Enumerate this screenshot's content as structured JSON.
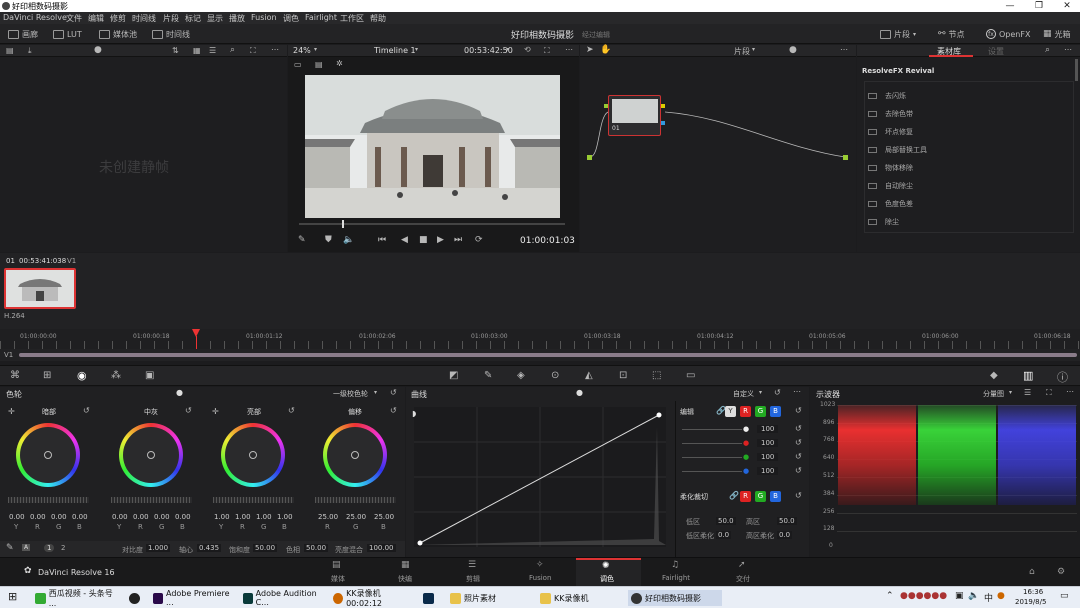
{
  "window": {
    "title": "好印相数码摄影"
  },
  "menu": [
    "DaVinci Resolve",
    "文件",
    "编辑",
    "修剪",
    "时间线",
    "片段",
    "标记",
    "显示",
    "播放",
    "Fusion",
    "调色",
    "Fairlight",
    "工作区",
    "帮助"
  ],
  "toolbar": {
    "gallery": "画廊",
    "lut": "LUT",
    "media_pool": "媒体池",
    "timeline": "时间线",
    "project": "好印相数码摄影",
    "status": "经过编辑",
    "clips": "片段",
    "nodes": "节点",
    "openfx": "OpenFX",
    "lightbox": "光箱"
  },
  "viewer": {
    "zoom": "24%",
    "timeline_name": "Timeline 1",
    "source_tc": "00:53:42:50",
    "no_still": "未创建静帧",
    "timecode": "01:00:01:03"
  },
  "node_panel": {
    "mode": "片段",
    "node_label": "01"
  },
  "fx_panel": {
    "tab_library": "素材库",
    "tab_settings": "设置",
    "header": "ResolveFX Revival",
    "items": [
      "去闪烁",
      "去除色带",
      "坏点修复",
      "局部替换工具",
      "物体移除",
      "自动除尘",
      "色度色差",
      "除尘"
    ]
  },
  "clip_strip": {
    "index": "01",
    "timecode": "00:53:41:038",
    "track": "V1",
    "codec": "H.264"
  },
  "ruler": [
    "01:00:00:00",
    "01:00:00:18",
    "01:00:01:12",
    "01:00:02:06",
    "01:00:03:00",
    "01:00:03:18",
    "01:00:04:12",
    "01:00:05:06",
    "01:00:06:00",
    "01:00:06:18"
  ],
  "track_label": "V1",
  "color_wheels": {
    "title": "色轮",
    "mode": "一级校色轮",
    "wheels": [
      {
        "name": "暗部",
        "values": [
          "0.00",
          "0.00",
          "0.00",
          "0.00"
        ]
      },
      {
        "name": "中灰",
        "values": [
          "0.00",
          "0.00",
          "0.00",
          "0.00"
        ]
      },
      {
        "name": "亮部",
        "values": [
          "1.00",
          "1.00",
          "1.00",
          "1.00"
        ]
      },
      {
        "name": "偏移",
        "values": [
          "25.00",
          "25.00",
          "25.00"
        ]
      }
    ],
    "channels4": [
      "Y",
      "R",
      "G",
      "B"
    ],
    "channels3": [
      "R",
      "G",
      "B"
    ],
    "pages": [
      "1",
      "2"
    ],
    "contrast_label": "对比度",
    "contrast": "1.000",
    "pivot_label": "轴心",
    "pivot": "0.435",
    "sat_label": "饱和度",
    "sat": "50.00",
    "hue_label": "色相",
    "hue": "50.00",
    "lum_label": "亮度混合",
    "lum": "100.00"
  },
  "curves": {
    "title": "曲线",
    "mode": "自定义",
    "edit_label": "编辑",
    "values": [
      "100",
      "100",
      "100",
      "100"
    ],
    "soft_clip": "柔化裁切",
    "low_label": "低区",
    "low": "50.0",
    "high_label": "高区",
    "high": "50.0",
    "low_soft_label": "低区柔化",
    "low_soft": "0.0",
    "high_soft_label": "高区柔化",
    "high_soft": "0.0",
    "Y": "Y",
    "R": "R",
    "G": "G",
    "B": "B"
  },
  "scopes": {
    "title": "示波器",
    "mode": "分量图",
    "scale": [
      "1023",
      "896",
      "768",
      "640",
      "512",
      "384",
      "256",
      "128",
      "0"
    ]
  },
  "bottom_nav": {
    "app": "DaVinci Resolve 16",
    "pages": [
      "媒体",
      "快编",
      "剪辑",
      "Fusion",
      "调色",
      "Fairlight",
      "交付"
    ],
    "active": "调色"
  },
  "taskbar": {
    "items": [
      "西瓜视频 - 头条号 ...",
      "Adobe Premiere ...",
      "Adobe Audition C...",
      "KK录像机 00:02:12",
      "照片素材",
      "KK录像机",
      "好印相数码摄影"
    ],
    "time": "16:36",
    "date": "2019/8/5"
  }
}
